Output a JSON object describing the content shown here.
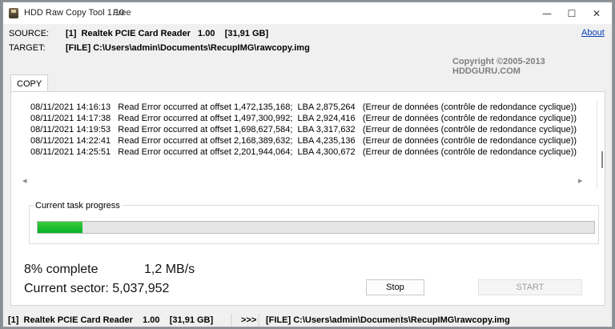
{
  "window": {
    "title": "HDD Raw Copy Tool 1.10",
    "edition": "Free",
    "controls": {
      "minimize": "—",
      "maximize": "☐",
      "close": "✕"
    }
  },
  "header": {
    "source_label": "SOURCE:",
    "source_value": "[1]  Realtek PCIE Card Reader   1.00    [31,91 GB]",
    "target_label": "TARGET:",
    "target_value": "[FILE] C:\\Users\\admin\\Documents\\RecupIMG\\rawcopy.img",
    "about_link": "About",
    "copyright": "Copyright ©2005-2013 HDDGURU.COM"
  },
  "tabs": [
    {
      "label": "COPY"
    }
  ],
  "log": [
    "08/11/2021 14:16:13   Read Error occurred at offset 1,472,135,168;  LBA 2,875,264   (Erreur de données (contrôle de redondance cyclique))",
    "08/11/2021 14:17:38   Read Error occurred at offset 1,497,300,992;  LBA 2,924,416   (Erreur de données (contrôle de redondance cyclique))",
    "08/11/2021 14:19:53   Read Error occurred at offset 1,698,627,584;  LBA 3,317,632   (Erreur de données (contrôle de redondance cyclique))",
    "08/11/2021 14:22:41   Read Error occurred at offset 2,168,389,632;  LBA 4,235,136   (Erreur de données (contrôle de redondance cyclique))",
    "08/11/2021 14:25:51   Read Error occurred at offset 2,201,944,064;  LBA 4,300,672   (Erreur de données (contrôle de redondance cyclique))"
  ],
  "progress": {
    "group_title": "Current task progress",
    "fraction": 0.08,
    "percent_text": "8% complete",
    "speed_text": "1,2 MB/s",
    "sector_text": "Current sector: 5,037,952"
  },
  "buttons": {
    "stop": "Stop",
    "start": "START"
  },
  "statusbar": {
    "source": "[1]  Realtek PCIE Card Reader    1.00    [31,91 GB]",
    "arrows": ">>>",
    "target": "[FILE] C:\\Users\\admin\\Documents\\RecupIMG\\rawcopy.img"
  },
  "colors": {
    "progress_fill": "#06b025",
    "link": "#0a3fb7"
  }
}
